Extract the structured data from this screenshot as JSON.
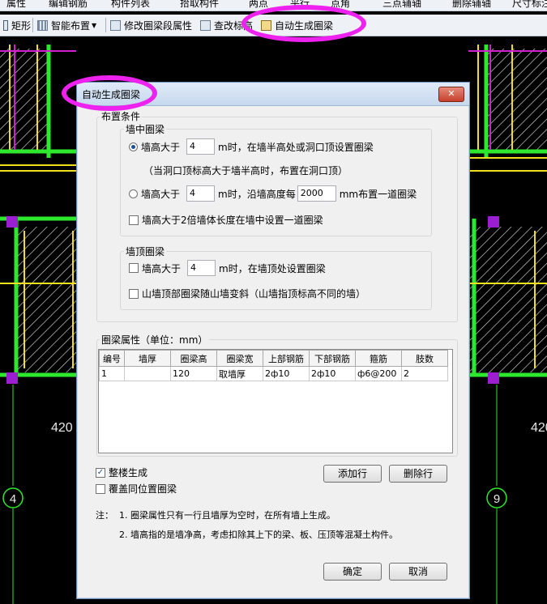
{
  "toolbar_top": {
    "items": [
      "属性",
      "编辑钢筋",
      "构件列表",
      "拾取构件",
      "两点",
      "平行",
      "点角",
      "三点辅轴",
      "删除辅轴",
      "尺寸标注"
    ]
  },
  "toolbar": {
    "rect_label": "矩形",
    "smart_layout_label": "智能布置",
    "modify_label": "修改圈梁段属性",
    "check_label": "查改标高",
    "auto_gen_label": "自动生成圈梁"
  },
  "cad": {
    "axis_labels": [
      "4",
      "9"
    ],
    "dimension_label": "420"
  },
  "dialog": {
    "title": "自动生成圈梁",
    "close_label": "✕",
    "layout_conditions_label": "布置条件",
    "wall_middle": {
      "label": "墙中圈梁",
      "opt1_prefix": "墙高大于",
      "opt1_value": "4",
      "opt1_suffix": "m时，在墙半高处或洞口顶设置圈梁",
      "opt1_note": "（当洞口顶标高大于墙半高时，布置在洞口顶）",
      "opt2_prefix": "墙高大于",
      "opt2_value": "4",
      "opt2_mid": "m时，沿墙高度每",
      "opt2_interval": "2000",
      "opt2_suffix": "mm布置一道圈梁",
      "chk_label": "墙高大于2倍墙体长度在墙中设置一道圈梁"
    },
    "wall_top": {
      "label": "墙顶圈梁",
      "chk1_prefix": "墙高大于",
      "chk1_value": "4",
      "chk1_suffix": "m时，在墙顶处设置圈梁",
      "chk2_label": "山墙顶部圈梁随山墙变斜（山墙指顶标高不同的墙）"
    },
    "beam_props_label": "圈梁属性（单位：mm）",
    "table": {
      "headers": [
        "编号",
        "墙厚",
        "圈梁高",
        "圈梁宽",
        "上部钢筋",
        "下部钢筋",
        "箍筋",
        "肢数"
      ],
      "rows": [
        [
          "1",
          "",
          "120",
          "取墙厚",
          "2ф10",
          "2ф10",
          "ф6@200",
          "2"
        ]
      ]
    },
    "whole_building_label": "整楼生成",
    "whole_building_checked": true,
    "cover_same_label": "覆盖同位置圈梁",
    "cover_same_checked": false,
    "add_row_label": "添加行",
    "delete_row_label": "删除行",
    "notes_prefix": "注：",
    "note1": "1. 圈梁属性只有一行且墙厚为空时，在所有墙上生成。",
    "note2": "2. 墙高指的是墙净高，考虑扣除其上下的梁、板、压顶等混凝土构件。",
    "ok_label": "确定",
    "cancel_label": "取消"
  }
}
